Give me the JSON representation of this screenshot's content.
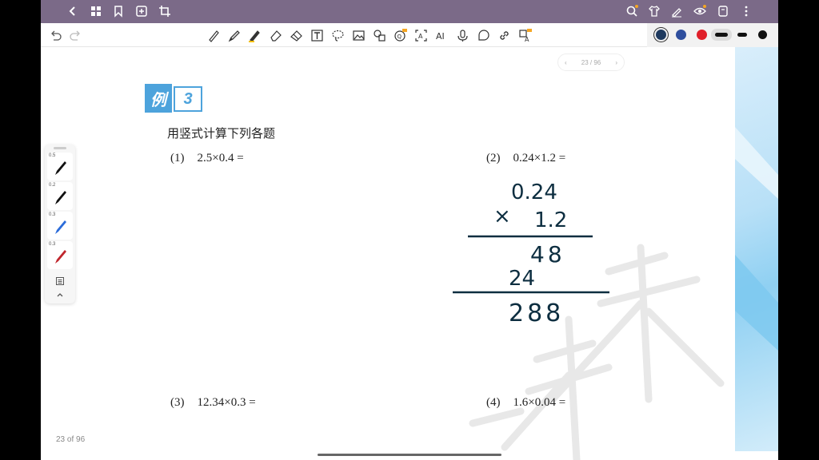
{
  "toolbar_colors": [
    "#1e3a5f",
    "#2f4f9e",
    "#e0202a",
    "#111111",
    "#111111",
    "#111111"
  ],
  "icons": {
    "nav": [
      "back-icon",
      "grid-icon",
      "bookmark-icon",
      "add-page-icon",
      "crop-icon"
    ],
    "right": [
      "search-icon",
      "shirt-icon",
      "pen-sign-icon",
      "eye-icon",
      "notebook-icon",
      "more-icon"
    ],
    "tools": [
      "pencil-icon",
      "marker-icon",
      "highlighter-icon",
      "eraser-icon",
      "eraser2-icon",
      "text-icon",
      "lasso-icon",
      "image-icon",
      "shape-icon",
      "ocr-icon",
      "text-recognize-icon",
      "ai-icon",
      "mic-icon",
      "sticker-icon",
      "link-icon",
      "translate-icon"
    ]
  },
  "pager": {
    "text": "23 / 96"
  },
  "example": {
    "label_char": "例",
    "number": "3"
  },
  "question": {
    "heading": "用竖式计算下列各题"
  },
  "problems": [
    {
      "num": "(1)",
      "expr": "2.5×0.4 ="
    },
    {
      "num": "(2)",
      "expr": "0.24×1.2 ="
    },
    {
      "num": "(3)",
      "expr": "12.34×0.3 ="
    },
    {
      "num": "(4)",
      "expr": "1.6×0.04 ="
    }
  ],
  "handwriting": {
    "line1": "0.24",
    "times": "×",
    "line2": "1.2",
    "partial1": "48",
    "partial2": "24",
    "result": "288"
  },
  "pens": [
    {
      "size": "0.5",
      "color": "#111111"
    },
    {
      "size": "0.2",
      "color": "#111111"
    },
    {
      "size": "0.3",
      "color": "#2b6cd9"
    },
    {
      "size": "0.3",
      "color": "#c0262d"
    }
  ],
  "footer": {
    "page_label": "23 of 96"
  }
}
